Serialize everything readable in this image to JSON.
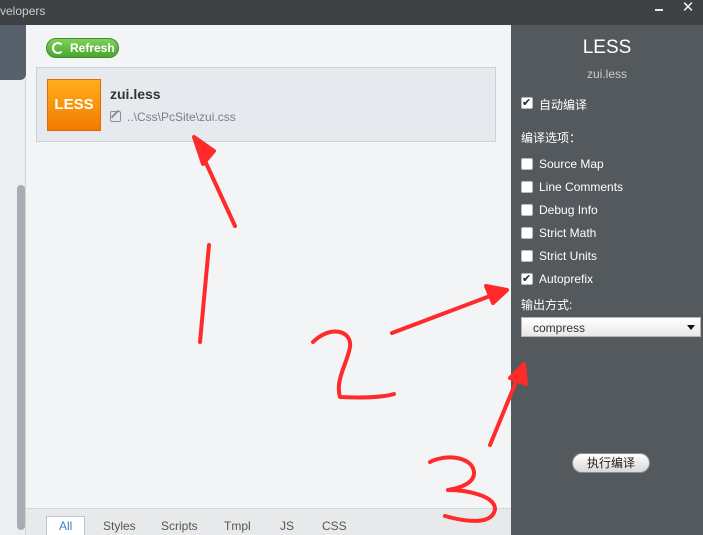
{
  "window": {
    "title": "velopers"
  },
  "toolbar": {
    "refresh_label": "Refresh"
  },
  "file": {
    "badge": "LESS",
    "name": "zui.less",
    "path": "..\\Css\\PcSite\\zui.css"
  },
  "tabs": [
    {
      "label": "All",
      "active": true
    },
    {
      "label": "Styles"
    },
    {
      "label": "Scripts"
    },
    {
      "label": "Tmpl"
    },
    {
      "label": "JS"
    },
    {
      "label": "CSS"
    }
  ],
  "panel": {
    "title": "LESS",
    "subtitle": "zui.less",
    "auto_compile": {
      "label": "自动编译",
      "checked": true
    },
    "options_heading": "编译选项：",
    "options": [
      {
        "label": "Source Map",
        "checked": false
      },
      {
        "label": "Line Comments",
        "checked": false
      },
      {
        "label": "Debug Info",
        "checked": false
      },
      {
        "label": "Strict Math",
        "checked": false
      },
      {
        "label": "Strict Units",
        "checked": false
      },
      {
        "label": "Autoprefix",
        "checked": true
      }
    ],
    "output_heading": "输出方式:",
    "output_value": "compress",
    "run_label": "执行编译"
  },
  "annotations": {
    "color": "#ff2a2a",
    "numbers": [
      "1",
      "2",
      "3"
    ]
  }
}
